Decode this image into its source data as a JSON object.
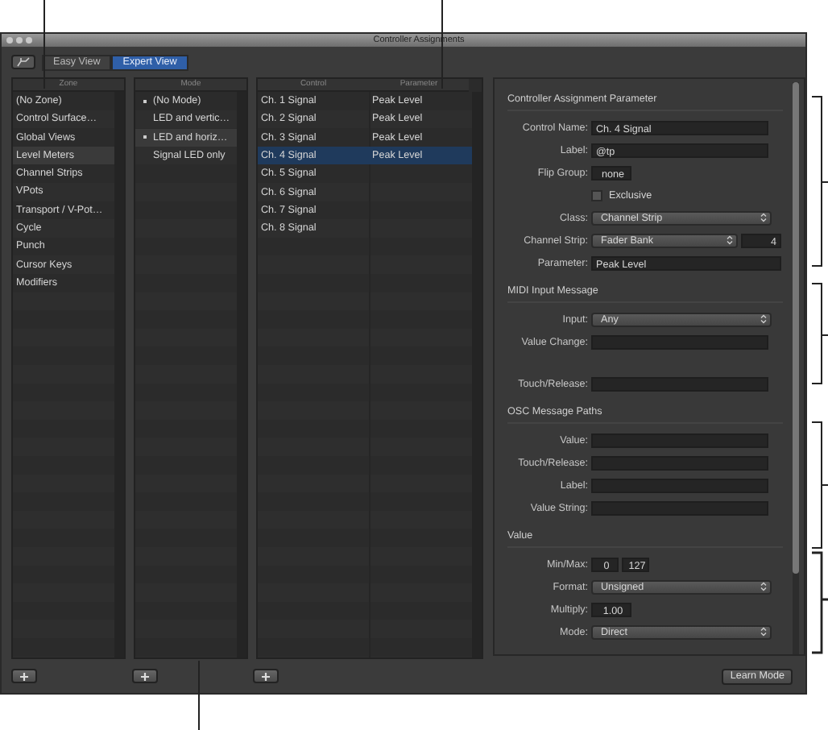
{
  "window": {
    "title": "Controller Assignments"
  },
  "toolbar": {
    "views": [
      {
        "label": "Easy View",
        "selected": false
      },
      {
        "label": "Expert View",
        "selected": true
      }
    ]
  },
  "zone_column": {
    "header": "Zone",
    "items": [
      {
        "label": "(No Zone)",
        "selected": false
      },
      {
        "label": "Control Surface…",
        "selected": false
      },
      {
        "label": "Global Views",
        "selected": false
      },
      {
        "label": "Level Meters",
        "selected": true
      },
      {
        "label": "Channel Strips",
        "selected": false
      },
      {
        "label": "VPots",
        "selected": false
      },
      {
        "label": "Transport / V-Pot…",
        "selected": false
      },
      {
        "label": "Cycle",
        "selected": false
      },
      {
        "label": "Punch",
        "selected": false
      },
      {
        "label": "Cursor Keys",
        "selected": false
      },
      {
        "label": "Modifiers",
        "selected": false
      }
    ]
  },
  "mode_column": {
    "header": "Mode",
    "items": [
      {
        "label": "(No Mode)",
        "active": true,
        "selected": false
      },
      {
        "label": "LED and vertic…",
        "active": false,
        "selected": false
      },
      {
        "label": "LED and horiz…",
        "active": true,
        "selected": true
      },
      {
        "label": "Signal LED only",
        "active": false,
        "selected": false
      }
    ]
  },
  "control_table": {
    "columns": [
      "Control",
      "Parameter"
    ],
    "rows": [
      {
        "control": "Ch. 1 Signal",
        "parameter": "Peak Level",
        "selected": false
      },
      {
        "control": "Ch. 2 Signal",
        "parameter": "Peak Level",
        "selected": false
      },
      {
        "control": "Ch. 3 Signal",
        "parameter": "Peak Level",
        "selected": false
      },
      {
        "control": "Ch. 4 Signal",
        "parameter": "Peak Level",
        "selected": true
      },
      {
        "control": "Ch. 5 Signal",
        "selected": false
      },
      {
        "control": "Ch. 6 Signal",
        "selected": false
      },
      {
        "control": "Ch. 7 Signal",
        "selected": false
      },
      {
        "control": "Ch. 8 Signal",
        "selected": false
      }
    ]
  },
  "inspector": {
    "sections": [
      {
        "title": "Controller Assignment Parameter",
        "rows": [
          {
            "kind": "text",
            "label": "Control Name:",
            "value": "Ch. 4 Signal"
          },
          {
            "kind": "text",
            "label": "Label:",
            "value": "@tp"
          },
          {
            "kind": "short",
            "label": "Flip Group:",
            "value": "none"
          },
          {
            "kind": "checkbox",
            "label": "Exclusive",
            "checked": false
          },
          {
            "kind": "popup",
            "label": "Class:",
            "value": "Channel Strip"
          },
          {
            "kind": "popup_number",
            "label": "Channel Strip:",
            "value": "Fader Bank",
            "number": "4"
          },
          {
            "kind": "wide",
            "label": "Parameter:",
            "value": "Peak Level"
          }
        ]
      },
      {
        "title": "MIDI Input Message",
        "rows": [
          {
            "kind": "popup",
            "label": "Input:",
            "value": "Any"
          },
          {
            "kind": "text",
            "label": "Value Change:"
          },
          {
            "kind": "text",
            "label": "Touch/Release:"
          }
        ]
      },
      {
        "title": "OSC Message Paths",
        "rows": [
          {
            "kind": "text",
            "label": "Value:"
          },
          {
            "kind": "text",
            "label": "Touch/Release:"
          },
          {
            "kind": "text",
            "label": "Label:"
          },
          {
            "kind": "text",
            "label": "Value String:"
          }
        ]
      },
      {
        "title": "Value",
        "rows": [
          {
            "kind": "pair",
            "label": "Min/Max:",
            "value": "0",
            "number": "127"
          },
          {
            "kind": "popup",
            "label": "Format:",
            "value": "Unsigned"
          },
          {
            "kind": "short",
            "label": "Multiply:",
            "value": "1.00"
          },
          {
            "kind": "popup",
            "label": "Mode:",
            "value": "Direct"
          }
        ]
      }
    ]
  },
  "learn_button": "Learn Mode"
}
